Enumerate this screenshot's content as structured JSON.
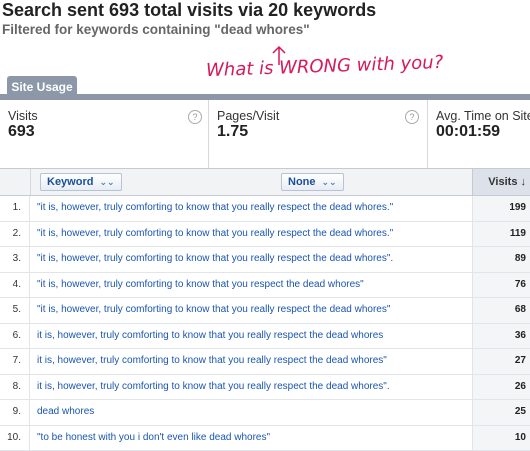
{
  "header": {
    "title": "Search sent 693 total visits via 20 keywords",
    "subtitle": "Filtered for keywords containing \"dead whores\"",
    "annotation": "What is WRONG with you?"
  },
  "tabs": {
    "site_usage": "Site Usage"
  },
  "metrics": [
    {
      "label": "Visits",
      "value": "693"
    },
    {
      "label": "Pages/Visit",
      "value": "1.75"
    },
    {
      "label": "Avg. Time on Site",
      "value": "00:01:59"
    }
  ],
  "help_glyph": "?",
  "table": {
    "keyword_header": "Keyword",
    "secondary_header": "None",
    "visits_header": "Visits",
    "sort_icon": "arrow-down-icon",
    "rows": [
      {
        "idx": "1.",
        "keyword": "\"it is, however, truly comforting to know that you really respect the dead whores.\"",
        "visits": "199"
      },
      {
        "idx": "2.",
        "keyword": "\"it is, however, truly comforting to know that you really respect the dead whores.\"",
        "visits": "119"
      },
      {
        "idx": "3.",
        "keyword": "\"it is, however, truly comforting to know that you really respect the dead whores\".",
        "visits": "89"
      },
      {
        "idx": "4.",
        "keyword": "\"it is, however, truly comforting to know that you respect the dead whores\"",
        "visits": "76"
      },
      {
        "idx": "5.",
        "keyword": "\"it is, however, truly comforting to know that you really respect the dead whores\"",
        "visits": "68"
      },
      {
        "idx": "6.",
        "keyword": "it is, however, truly comforting to know that you really respect the dead whores",
        "visits": "36"
      },
      {
        "idx": "7.",
        "keyword": "it is, however, truly comforting to know that you really respect the dead whores\"",
        "visits": "27"
      },
      {
        "idx": "8.",
        "keyword": "it is, however, truly comforting to know that you really respect the dead whores\".",
        "visits": "26"
      },
      {
        "idx": "9.",
        "keyword": "dead whores",
        "visits": "25"
      },
      {
        "idx": "10.",
        "keyword": "\"to be honest with you i don't even like dead whores\"",
        "visits": "10"
      }
    ]
  },
  "colors": {
    "accent_link": "#1a55b0",
    "annotation": "#d6195a",
    "tab": "#8c97a7"
  }
}
